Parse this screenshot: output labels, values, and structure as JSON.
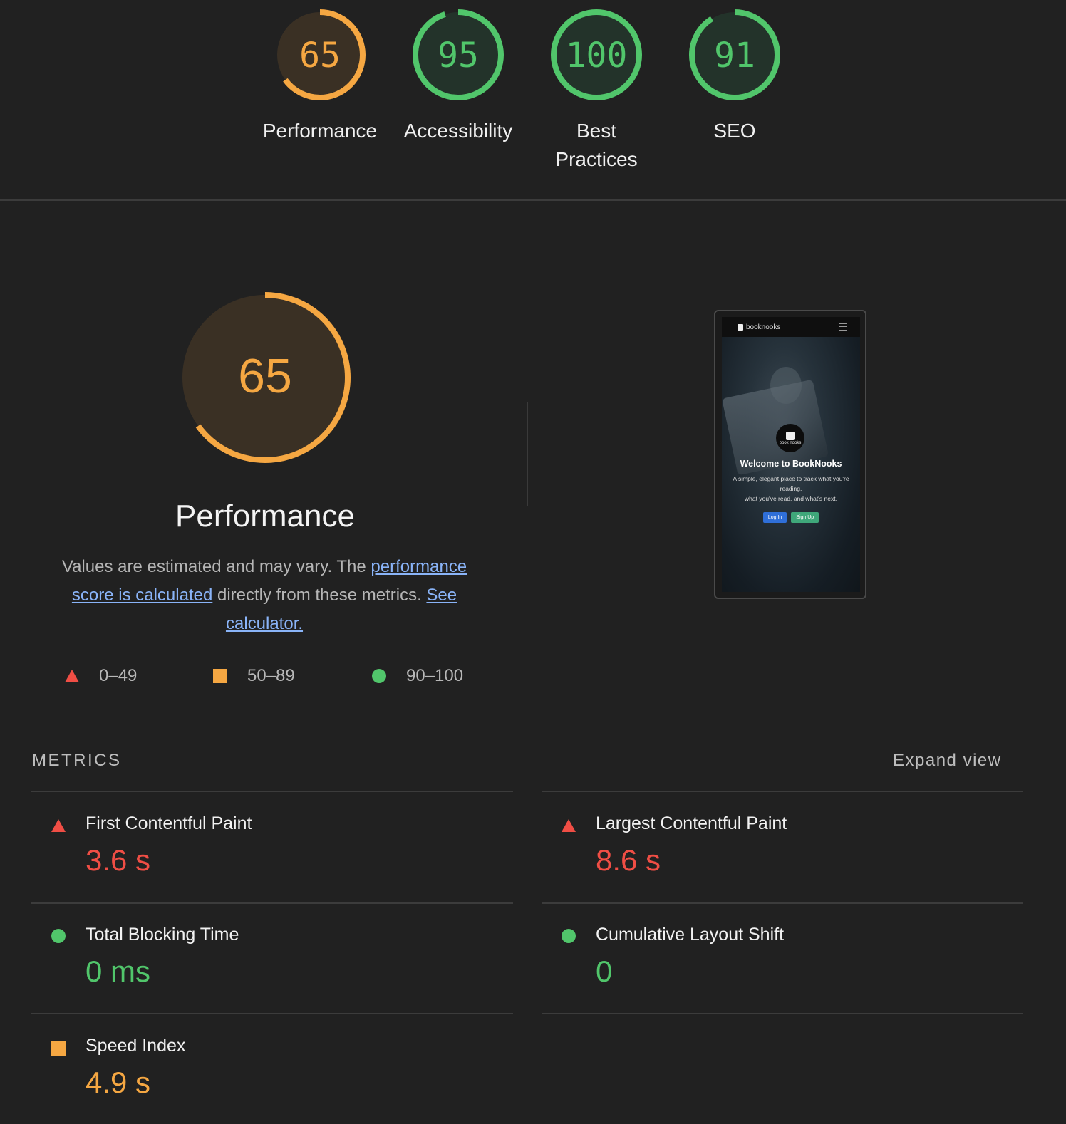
{
  "categories": [
    {
      "label": "Performance",
      "score": "65",
      "fraction": 0.65,
      "color": "#f5a742",
      "track": "#3a3024"
    },
    {
      "label": "Accessibility",
      "score": "95",
      "fraction": 0.95,
      "color": "#51c66b",
      "track": "#23332a"
    },
    {
      "label": "Best Practices",
      "score": "100",
      "fraction": 1.0,
      "color": "#51c66b",
      "track": "#23332a"
    },
    {
      "label": "SEO",
      "score": "91",
      "fraction": 0.91,
      "color": "#51c66b",
      "track": "#23332a"
    }
  ],
  "performance": {
    "score": "65",
    "fraction": 0.65,
    "title": "Performance",
    "desc_prefix": "Values are estimated and may vary. The ",
    "desc_link1": "performance score is calculated",
    "desc_mid": " directly from these metrics. ",
    "desc_link2": "See calculator."
  },
  "legend": [
    {
      "icon": "fail-triangle",
      "range": "0–49"
    },
    {
      "icon": "average-square",
      "range": "50–89"
    },
    {
      "icon": "pass-circle",
      "range": "90–100"
    }
  ],
  "screenshot": {
    "brand": "booknooks",
    "logo_text": "book nooks",
    "heading": "Welcome to BookNooks",
    "subtext_1": "A simple, elegant place to track what you're reading,",
    "subtext_2": "what you've read, and what's next.",
    "login": "Log In",
    "signup": "Sign Up"
  },
  "metrics_header": {
    "title": "METRICS",
    "expand": "Expand view"
  },
  "metrics": [
    {
      "label": "First Contentful Paint",
      "value": "3.6 s",
      "rating": "bad"
    },
    {
      "label": "Largest Contentful Paint",
      "value": "8.6 s",
      "rating": "bad"
    },
    {
      "label": "Total Blocking Time",
      "value": "0 ms",
      "rating": "good"
    },
    {
      "label": "Cumulative Layout Shift",
      "value": "0",
      "rating": "good"
    },
    {
      "label": "Speed Index",
      "value": "4.9 s",
      "rating": "avg"
    }
  ],
  "colors": {
    "fail": "#f04e45",
    "average": "#f5a742",
    "pass": "#51c66b",
    "background": "#212121"
  }
}
